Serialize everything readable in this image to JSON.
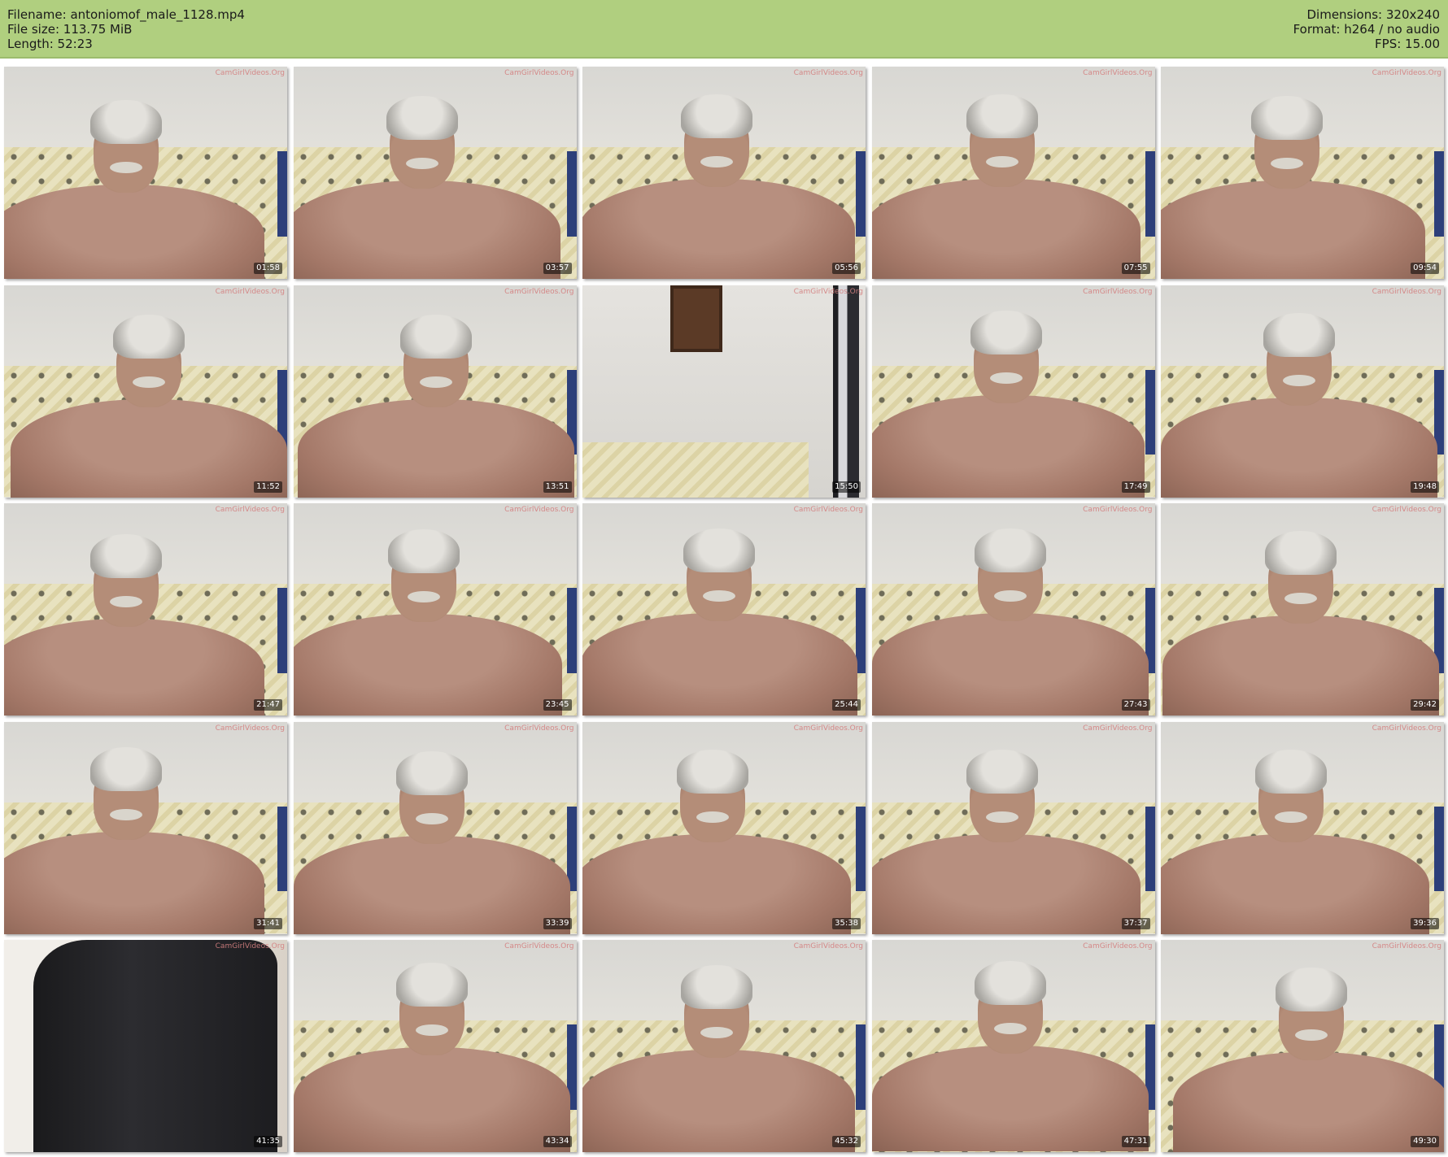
{
  "header": {
    "filename_line": "Filename: antoniomof_male_1128.mp4",
    "filesize_line": "File size: 113.75 MiB",
    "length_line": "Length: 52:23",
    "dimensions_line": "Dimensions: 320x240",
    "format_line": "Format: h264 / no audio",
    "fps_line": "FPS: 15.00",
    "background_color": "#b0cf7f"
  },
  "watermark": "CamGirlVideos.Org",
  "thumbnails": [
    {
      "timestamp": "01:58"
    },
    {
      "timestamp": "03:57"
    },
    {
      "timestamp": "05:56"
    },
    {
      "timestamp": "07:55"
    },
    {
      "timestamp": "09:54"
    },
    {
      "timestamp": "11:52"
    },
    {
      "timestamp": "13:51"
    },
    {
      "timestamp": "15:50"
    },
    {
      "timestamp": "17:49"
    },
    {
      "timestamp": "19:48"
    },
    {
      "timestamp": "21:47"
    },
    {
      "timestamp": "23:45"
    },
    {
      "timestamp": "25:44"
    },
    {
      "timestamp": "27:43"
    },
    {
      "timestamp": "29:42"
    },
    {
      "timestamp": "31:41"
    },
    {
      "timestamp": "33:39"
    },
    {
      "timestamp": "35:38"
    },
    {
      "timestamp": "37:37"
    },
    {
      "timestamp": "39:36"
    },
    {
      "timestamp": "41:35"
    },
    {
      "timestamp": "43:34"
    },
    {
      "timestamp": "45:32"
    },
    {
      "timestamp": "47:31"
    },
    {
      "timestamp": "49:30"
    }
  ]
}
